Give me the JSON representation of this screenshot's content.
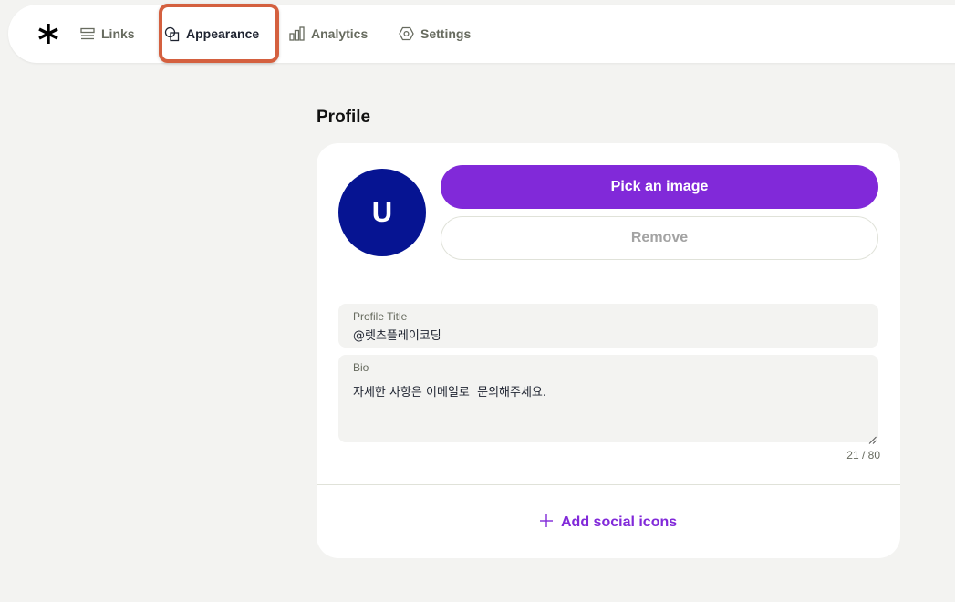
{
  "nav": {
    "logo_icon": "linktree-asterisk-icon",
    "items": [
      {
        "label": "Links",
        "icon": "links-icon",
        "active": false
      },
      {
        "label": "Appearance",
        "icon": "appearance-shapes-icon",
        "active": true
      },
      {
        "label": "Analytics",
        "icon": "bar-chart-icon",
        "active": false
      },
      {
        "label": "Settings",
        "icon": "gear-hexagon-icon",
        "active": false
      }
    ]
  },
  "profile": {
    "heading": "Profile",
    "avatar_initial": "U",
    "pick_image_label": "Pick an image",
    "remove_label": "Remove",
    "title_field": {
      "label": "Profile Title",
      "value": "@렛츠플레이코딩"
    },
    "bio_field": {
      "label": "Bio",
      "value": "자세한 사항은 이메일로  문의해주세요."
    },
    "bio_counter": "21 / 80",
    "add_social_label": "Add social icons"
  },
  "colors": {
    "background": "#f3f3f1",
    "accent_purple": "#8129d9",
    "avatar_blue": "#061492",
    "highlight_orange": "#d4603f"
  }
}
